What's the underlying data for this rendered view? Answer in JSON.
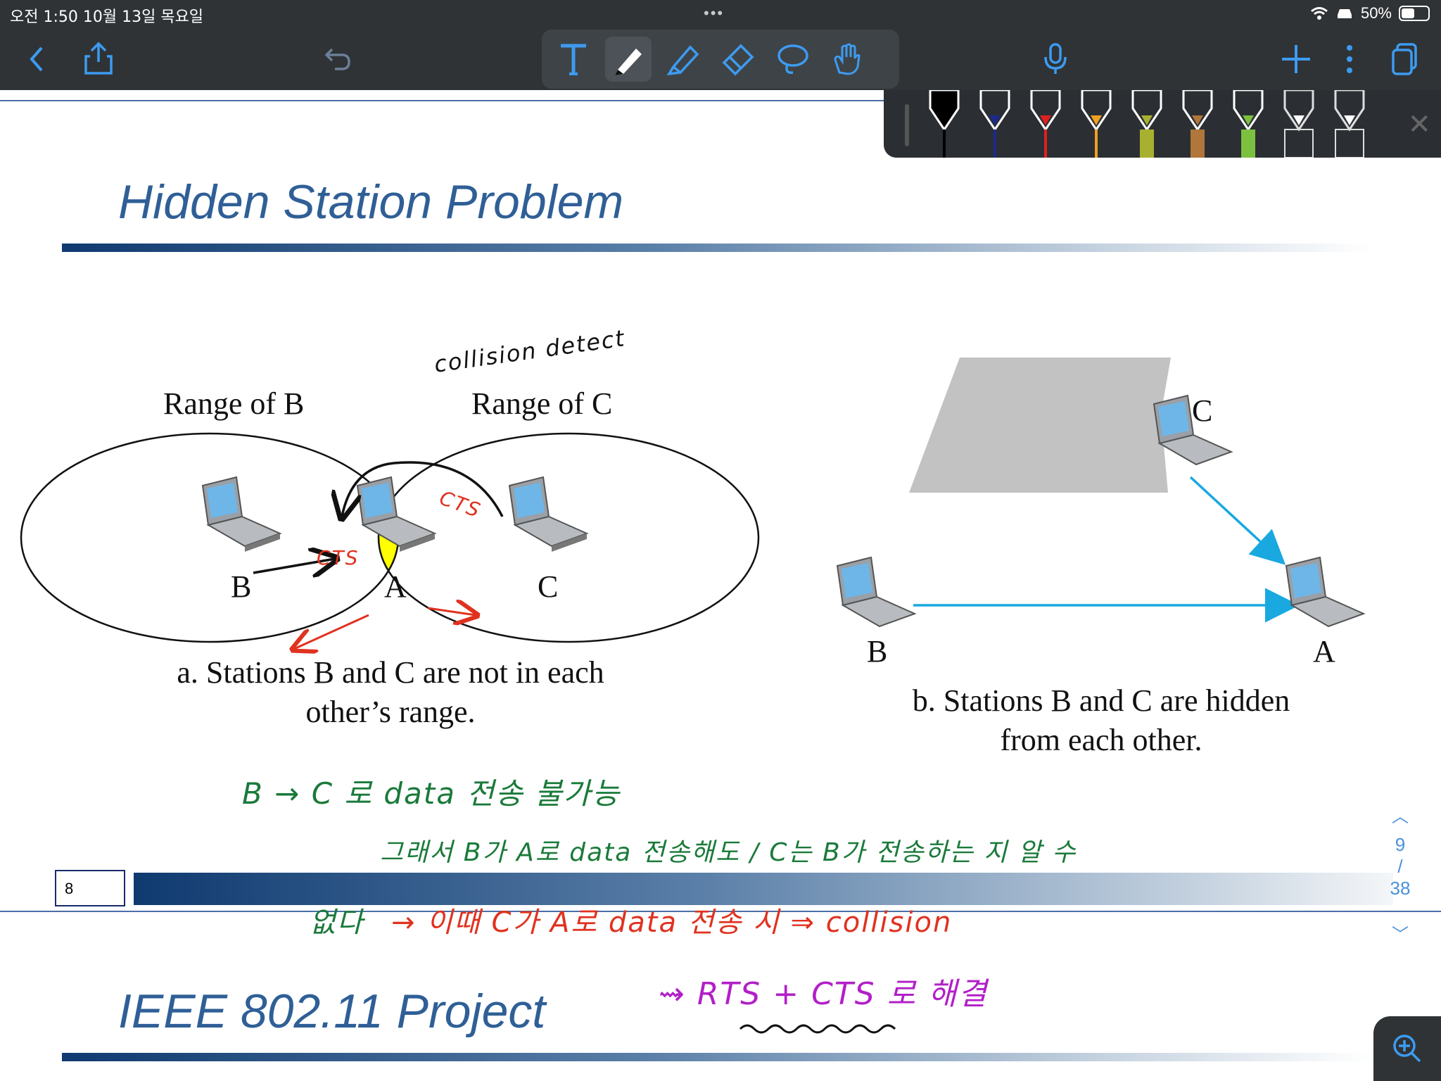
{
  "status": {
    "time": "오전 1:50   10월 13일 목요일",
    "more": "•••",
    "battery_percent": "50%"
  },
  "toolbar": {
    "back": "back-icon",
    "share": "share-icon",
    "undo": "undo-icon",
    "tools": [
      "text-tool",
      "pen-tool",
      "highlighter-tool",
      "eraser-tool",
      "lasso-tool",
      "hand-tool"
    ],
    "mic": "microphone-icon",
    "add": "plus-icon",
    "more": "more-icon",
    "pages": "pages-icon"
  },
  "pens": [
    {
      "color": "#000000"
    },
    {
      "color": "#1c2a8a"
    },
    {
      "color": "#e02020"
    },
    {
      "color": "#f0a020"
    },
    {
      "color": "#a8b030"
    },
    {
      "color": "#b0763a"
    },
    {
      "color": "#7cc040"
    },
    {
      "color": "#ffffff"
    },
    {
      "color": "#ffffff"
    }
  ],
  "slide1": {
    "title": "Hidden Station Problem",
    "range_b": "Range of B",
    "range_c": "Range of C",
    "label_b": "B",
    "label_a": "A",
    "label_c": "C",
    "caption_a_line1": "a. Stations B and C are not in each",
    "caption_a_line2": "other’s range.",
    "b_label_c": "C",
    "b_label_b": "B",
    "b_label_a": "A",
    "caption_b_line1": "b. Stations B and C are hidden",
    "caption_b_line2": "from each other."
  },
  "annotations": {
    "collision": "collision detect",
    "cts1": "CTS",
    "cts2": "CTS",
    "line1": "B  →  C 로    data 전송 불가능",
    "line2": "그래서    B가   A로   data  전송해도  /   C는   B가  전송하는 지   알 수",
    "line3_green": "없다",
    "line3_red": "→   이때   C가  A로    data  전송 시   ⇒  collision",
    "line4": "⇝  RTS + CTS 로   해결"
  },
  "footer": {
    "page_box": "8"
  },
  "slide2": {
    "title": "IEEE 802.11 Project"
  },
  "pager": {
    "current": "9",
    "separator": "/",
    "total": "38"
  }
}
